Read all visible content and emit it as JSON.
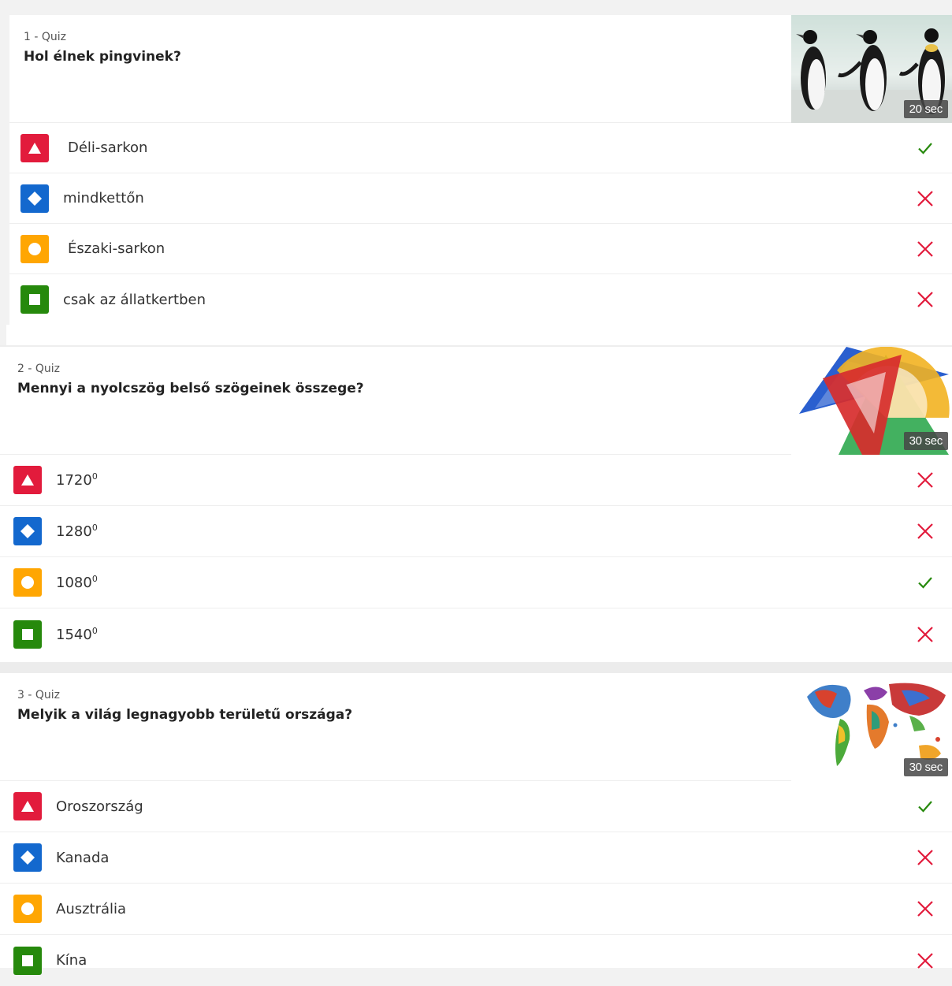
{
  "colors": {
    "triangle": "#e21b3c",
    "diamond": "#1368ce",
    "circle": "#ffa602",
    "square": "#26890c",
    "correct": "#26890c",
    "wrong": "#e21b3c"
  },
  "questions": [
    {
      "number": "1 - Quiz",
      "title": "Hol élnek pingvinek?",
      "time": "20 sec",
      "image": "penguins-image",
      "answers": [
        {
          "shape": "triangle",
          "text": "Déli-sarkon",
          "correct": true
        },
        {
          "shape": "diamond",
          "text": "mindkettőn",
          "correct": false
        },
        {
          "shape": "circle",
          "text": "Északi-sarkon",
          "correct": false
        },
        {
          "shape": "square",
          "text": "csak az állatkertben",
          "correct": false
        }
      ]
    },
    {
      "number": "2 - Quiz",
      "title": "Mennyi a nyolcszög belső szögeinek összege?",
      "time": "30 sec",
      "image": "geometry-tools-image",
      "answers": [
        {
          "shape": "triangle",
          "text": "1720",
          "sup": "0",
          "correct": false
        },
        {
          "shape": "diamond",
          "text": "1280",
          "sup": "0",
          "correct": false
        },
        {
          "shape": "circle",
          "text": "1080",
          "sup": "0",
          "correct": true
        },
        {
          "shape": "square",
          "text": "1540",
          "sup": "0",
          "correct": false
        }
      ]
    },
    {
      "number": "3 - Quiz",
      "title": "Melyik a világ legnagyobb területű országa?",
      "time": "30 sec",
      "image": "world-map-image",
      "answers": [
        {
          "shape": "triangle",
          "text": "Oroszország",
          "correct": true
        },
        {
          "shape": "diamond",
          "text": "Kanada",
          "correct": false
        },
        {
          "shape": "circle",
          "text": "Ausztrália",
          "correct": false
        },
        {
          "shape": "square",
          "text": "Kína",
          "correct": false
        }
      ]
    }
  ]
}
